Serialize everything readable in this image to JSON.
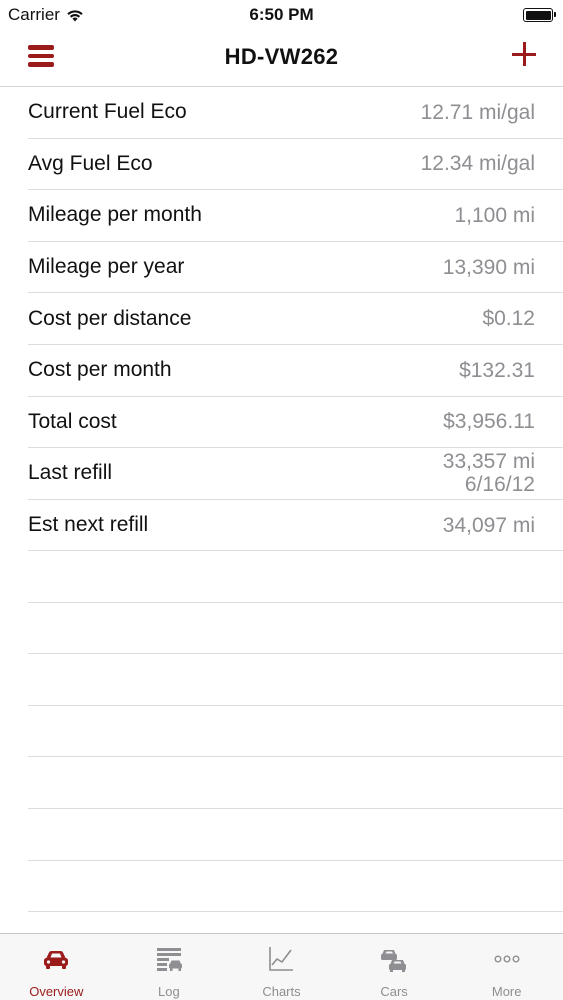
{
  "status_bar": {
    "carrier": "Carrier",
    "time": "6:50 PM"
  },
  "nav": {
    "title": "HD-VW262",
    "left_icon": "hamburger-menu-icon",
    "right_icon": "plus-icon",
    "accent_color": "#9b1b1b"
  },
  "stats": [
    {
      "label": "Current Fuel Eco",
      "value": "12.71 mi/gal"
    },
    {
      "label": "Avg Fuel Eco",
      "value": "12.34 mi/gal"
    },
    {
      "label": "Mileage per month",
      "value": "1,100 mi"
    },
    {
      "label": "Mileage per year",
      "value": "13,390 mi"
    },
    {
      "label": "Cost per distance",
      "value": "$0.12"
    },
    {
      "label": "Cost per month",
      "value": "$132.31"
    },
    {
      "label": "Total cost",
      "value": "$3,956.11"
    },
    {
      "label": "Last refill",
      "value": "33,357 mi",
      "value_line2": "6/16/12"
    },
    {
      "label": "Est next refill",
      "value": "34,097 mi"
    }
  ],
  "tabs": [
    {
      "label": "Overview",
      "icon": "car-icon",
      "active": true
    },
    {
      "label": "Log",
      "icon": "log-icon",
      "active": false
    },
    {
      "label": "Charts",
      "icon": "chart-icon",
      "active": false
    },
    {
      "label": "Cars",
      "icon": "cars-icon",
      "active": false
    },
    {
      "label": "More",
      "icon": "more-icon",
      "active": false
    }
  ]
}
